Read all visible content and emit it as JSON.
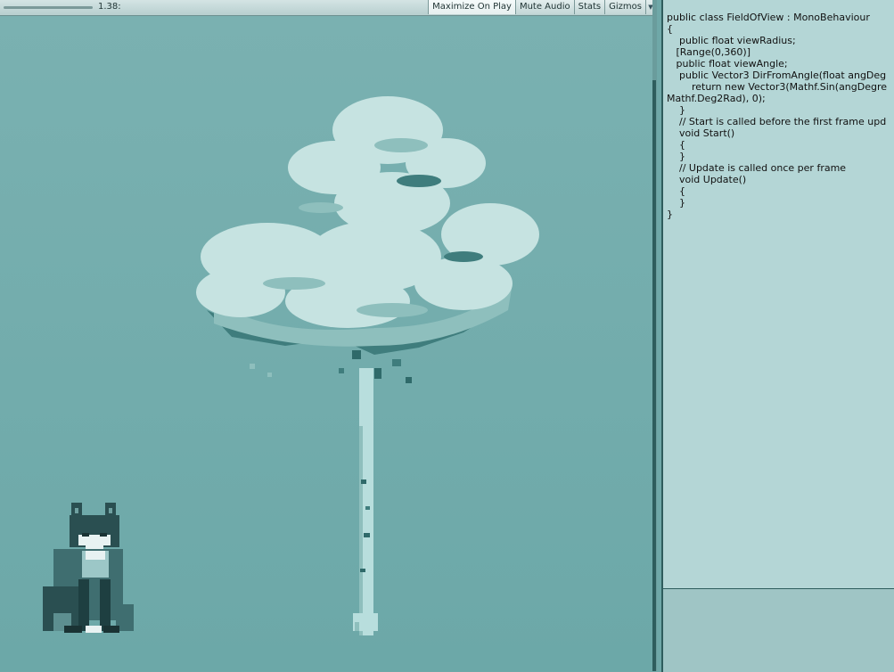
{
  "toolbar": {
    "scale_value": "1.38:",
    "buttons": {
      "maximize_on_play": "Maximize On Play",
      "mute_audio": "Mute Audio",
      "stats": "Stats",
      "gizmos": "Gizmos"
    },
    "dropdown_icon": "chevron-down-icon"
  },
  "colors": {
    "sky": "#6fa8a8",
    "foliage_light": "#c6e3e1",
    "foliage_mid": "#8ebfbd",
    "foliage_dark": "#3f7d7d",
    "fox_dark": "#1e3f41",
    "fox_light": "#e8f2f2"
  },
  "code": {
    "lines": [
      "public class FieldOfView : MonoBehaviour",
      "{",
      "    public float viewRadius;",
      "   [Range(0,360)]",
      "   public float viewAngle;",
      "",
      "    public Vector3 DirFromAngle(float angDeg",
      "        return new Vector3(Mathf.Sin(angDegre",
      "Mathf.Deg2Rad), 0);",
      "    }",
      "    // Start is called before the first frame upd",
      "    void Start()",
      "    {",
      "",
      "    }",
      "",
      "    // Update is called once per frame",
      "    void Update()",
      "    {",
      "",
      "    }",
      "}"
    ]
  }
}
